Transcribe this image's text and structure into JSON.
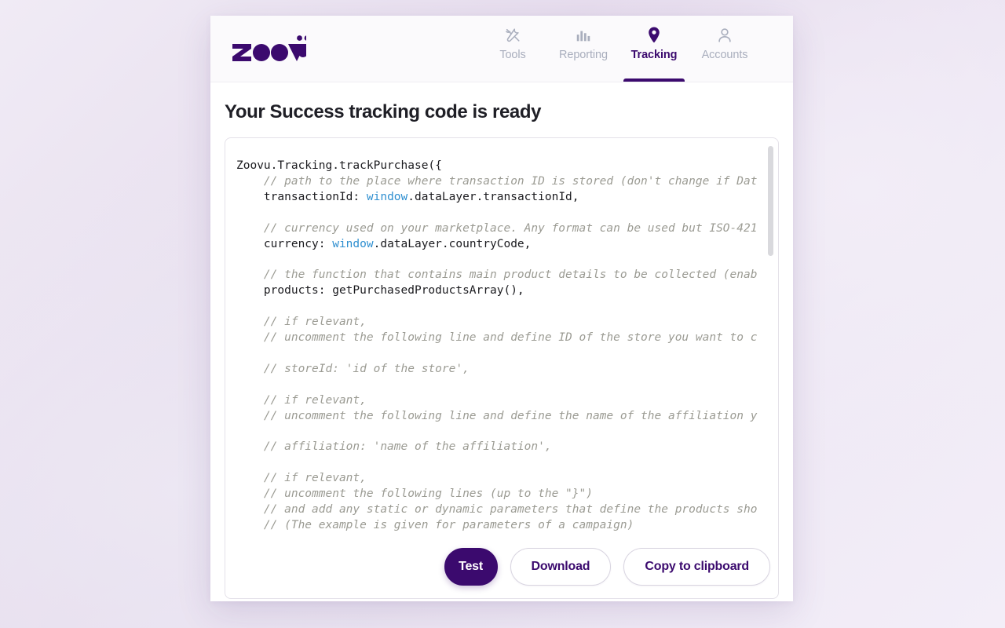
{
  "brand": {
    "name": "zoovü",
    "color": "#3b0a6e"
  },
  "nav": {
    "items": [
      {
        "label": "Tools",
        "icon": "tools-icon",
        "active": false
      },
      {
        "label": "Reporting",
        "icon": "bar-chart-icon",
        "active": false
      },
      {
        "label": "Tracking",
        "icon": "location-pin-icon",
        "active": true
      },
      {
        "label": "Accounts",
        "icon": "user-icon",
        "active": false
      }
    ]
  },
  "page": {
    "title": "Your Success tracking code is ready"
  },
  "code": {
    "lines": [
      {
        "text": "Zoovu.Tracking.trackPurchase({",
        "type": "code"
      },
      {
        "text": "    // path to the place where transaction ID is stored (don't change if Dat",
        "type": "comment"
      },
      {
        "text": "    transactionId: window.dataLayer.transactionId,",
        "type": "code-window"
      },
      {
        "text": "",
        "type": "blank"
      },
      {
        "text": "    // currency used on your marketplace. Any format can be used but ISO-421",
        "type": "comment"
      },
      {
        "text": "    currency: window.dataLayer.countryCode,",
        "type": "code-window"
      },
      {
        "text": "",
        "type": "blank"
      },
      {
        "text": "    // the function that contains main product details to be collected (enab",
        "type": "comment"
      },
      {
        "text": "    products: getPurchasedProductsArray(),",
        "type": "code"
      },
      {
        "text": "",
        "type": "blank"
      },
      {
        "text": "    // if relevant,",
        "type": "comment"
      },
      {
        "text": "    // uncomment the following line and define ID of the store you want to c",
        "type": "comment"
      },
      {
        "text": "",
        "type": "blank"
      },
      {
        "text": "    // storeId: 'id of the store',",
        "type": "comment"
      },
      {
        "text": "",
        "type": "blank"
      },
      {
        "text": "    // if relevant,",
        "type": "comment"
      },
      {
        "text": "    // uncomment the following line and define the name of the affiliation y",
        "type": "comment"
      },
      {
        "text": "",
        "type": "blank"
      },
      {
        "text": "    // affiliation: 'name of the affiliation',",
        "type": "comment"
      },
      {
        "text": "",
        "type": "blank"
      },
      {
        "text": "    // if relevant,",
        "type": "comment"
      },
      {
        "text": "    // uncomment the following lines (up to the \"}\")",
        "type": "comment"
      },
      {
        "text": "    // and add any static or dynamic parameters that define the products sho",
        "type": "comment"
      },
      {
        "text": "    // (The example is given for parameters of a campaign)",
        "type": "comment"
      }
    ]
  },
  "buttons": {
    "test": "Test",
    "download": "Download",
    "copy": "Copy to clipboard"
  }
}
